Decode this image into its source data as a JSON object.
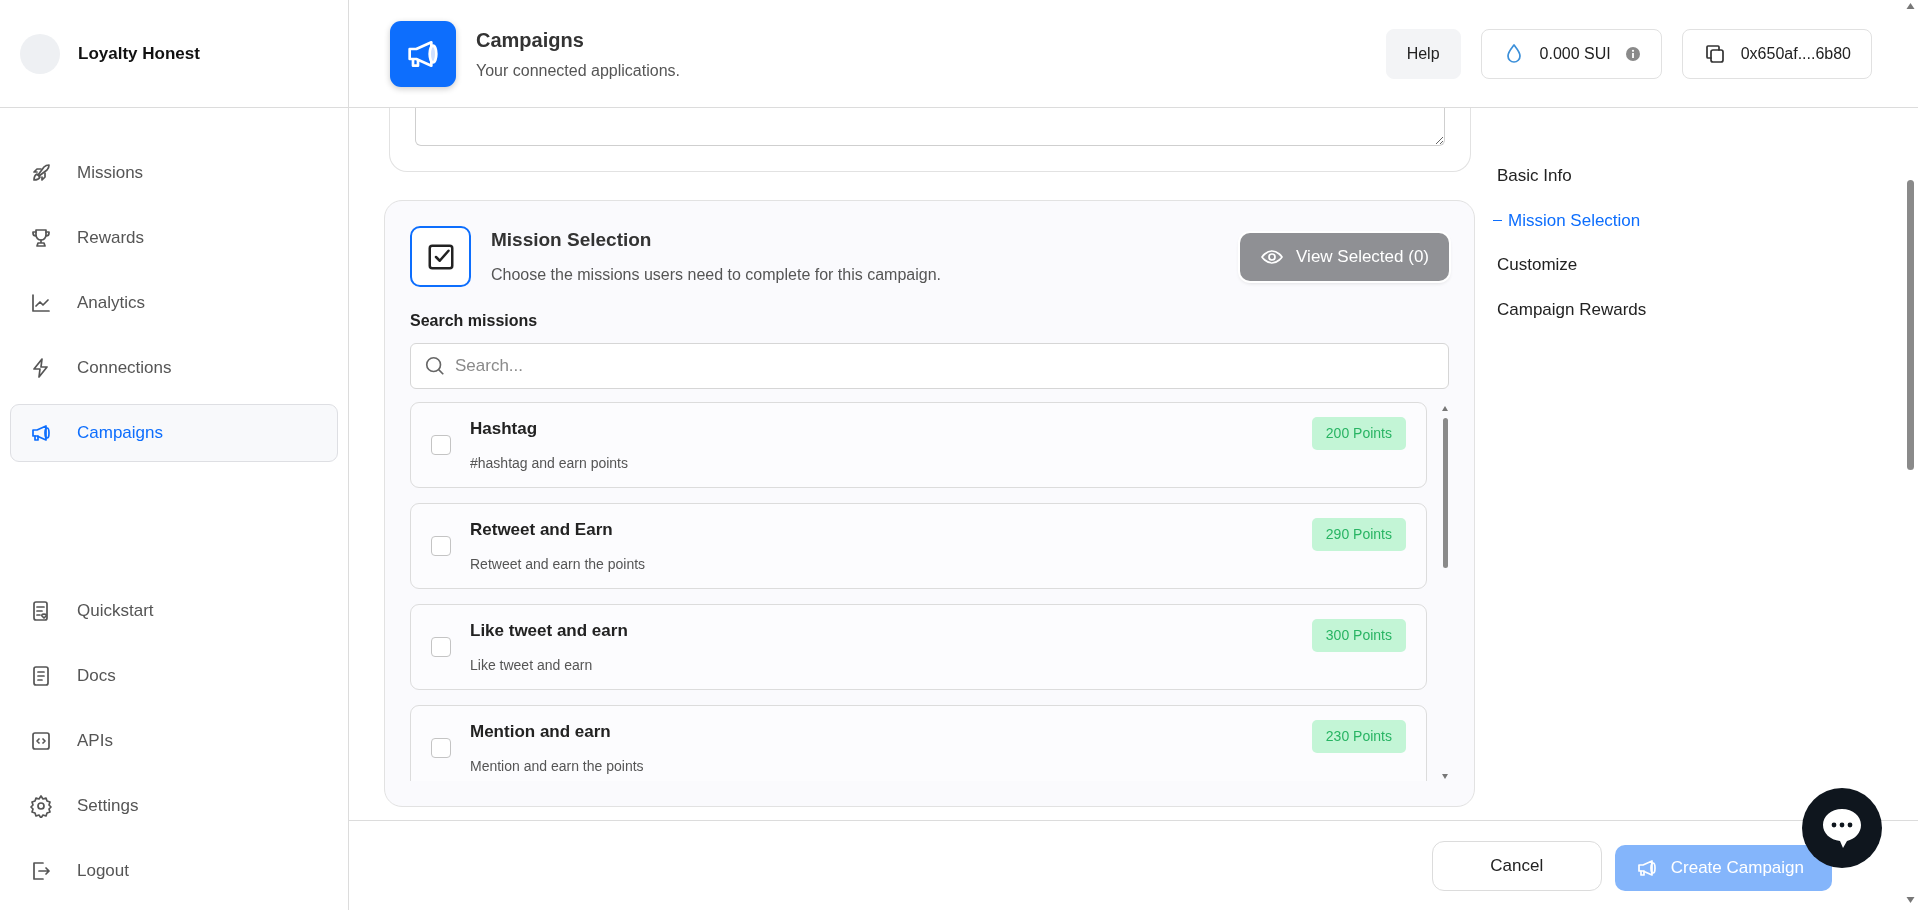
{
  "sidebar": {
    "brand": "Loyalty Honest",
    "items": [
      {
        "label": "Missions",
        "kind": "rocket",
        "selected": false
      },
      {
        "label": "Rewards",
        "kind": "trophy",
        "selected": false
      },
      {
        "label": "Analytics",
        "kind": "chart",
        "selected": false
      },
      {
        "label": "Connections",
        "kind": "bolt",
        "selected": false
      },
      {
        "label": "Campaigns",
        "kind": "megaphone",
        "selected": true
      }
    ],
    "bottom_items": [
      {
        "label": "Quickstart",
        "kind": "checklist"
      },
      {
        "label": "Docs",
        "kind": "doc"
      },
      {
        "label": "APIs",
        "kind": "code"
      },
      {
        "label": "Settings",
        "kind": "gear"
      },
      {
        "label": "Logout",
        "kind": "logout"
      }
    ]
  },
  "header": {
    "title": "Campaigns",
    "subtitle": "Your connected applications.",
    "help": "Help",
    "balance": "0.000 SUI",
    "wallet": "0x650af....6b80"
  },
  "mission_selection": {
    "title": "Mission Selection",
    "description": "Choose the missions users need to complete for this campaign.",
    "view_selected": "View Selected (0)",
    "search_label": "Search missions",
    "search_placeholder": "Search...",
    "missions": [
      {
        "title": "Hashtag",
        "description": "#hashtag and earn points",
        "points": "200 Points",
        "checked": false
      },
      {
        "title": "Retweet and Earn",
        "description": "Retweet and earn the points",
        "points": "290 Points",
        "checked": false
      },
      {
        "title": "Like tweet and earn",
        "description": "Like tweet and earn",
        "points": "300 Points",
        "checked": false
      },
      {
        "title": "Mention and earn",
        "description": "Mention and earn the points",
        "points": "230 Points",
        "checked": false
      }
    ]
  },
  "toc": [
    {
      "label": "Basic Info",
      "selected": false
    },
    {
      "label": "Mission Selection",
      "selected": true
    },
    {
      "label": "Customize",
      "selected": false
    },
    {
      "label": "Campaign Rewards",
      "selected": false
    }
  ],
  "footer": {
    "cancel": "Cancel",
    "create": "Create Campaign",
    "create_disabled": true
  }
}
